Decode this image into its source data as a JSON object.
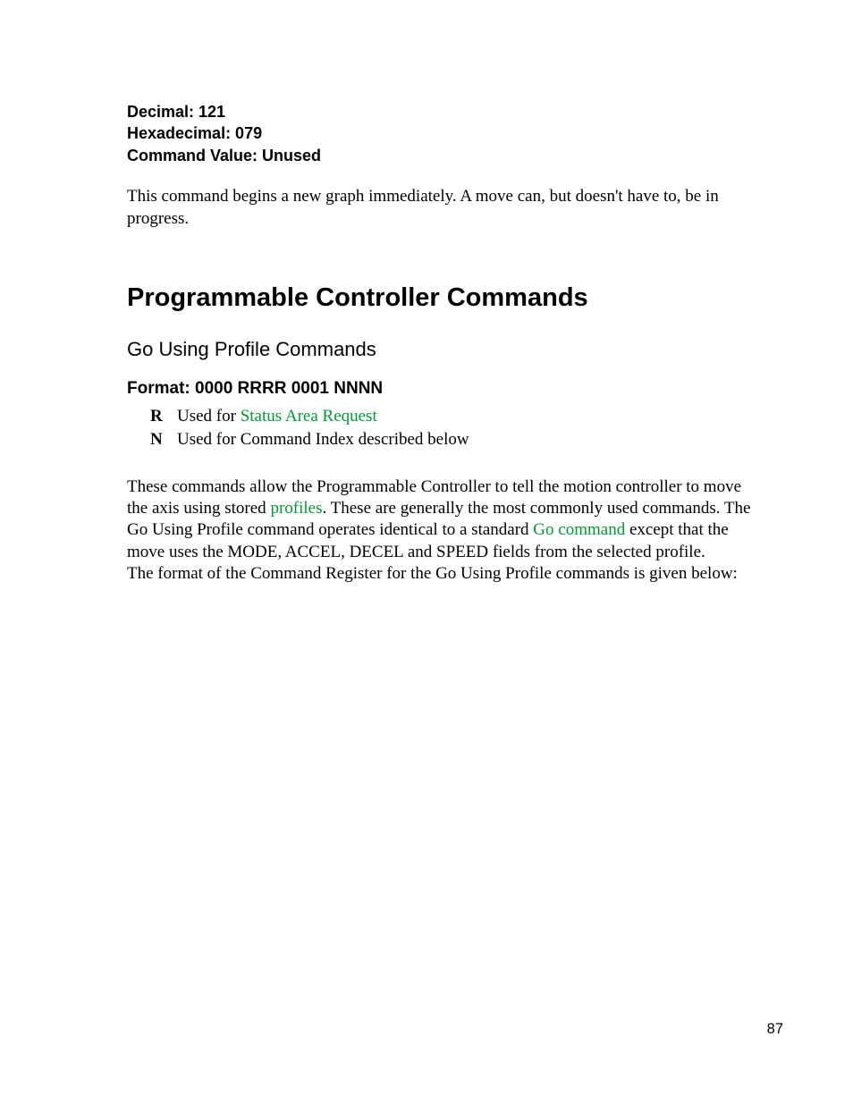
{
  "header": {
    "decimal": "Decimal: 121",
    "hex": "Hexadecimal: 079",
    "cmdval": "Command Value: Unused"
  },
  "para1": "This command begins a new graph immediately.  A move can, but doesn't have to, be in progress.",
  "h1": "Programmable Controller Commands",
  "h2": "Go Using Profile Commands",
  "h3": "Format: 0000 RRRR 0001 NNNN",
  "defs": {
    "r_key": "R",
    "r_text_before": "Used for ",
    "r_link": "Status Area Request",
    "n_key": "N",
    "n_text": "Used for Command Index described below"
  },
  "para2": {
    "t1": "These commands allow the Programmable Controller to tell the motion controller to move the axis using stored ",
    "link1": "profiles",
    "t2": ".  These are generally the most commonly used commands.  The Go Using Profile command operates identical to a standard ",
    "link2": "Go command",
    "t3": " except that the move uses the MODE, ACCEL, DECEL and SPEED fields from the selected profile.",
    "t4": "The format of the Command Register for the Go Using Profile commands is given below:"
  },
  "pagenum": "87"
}
